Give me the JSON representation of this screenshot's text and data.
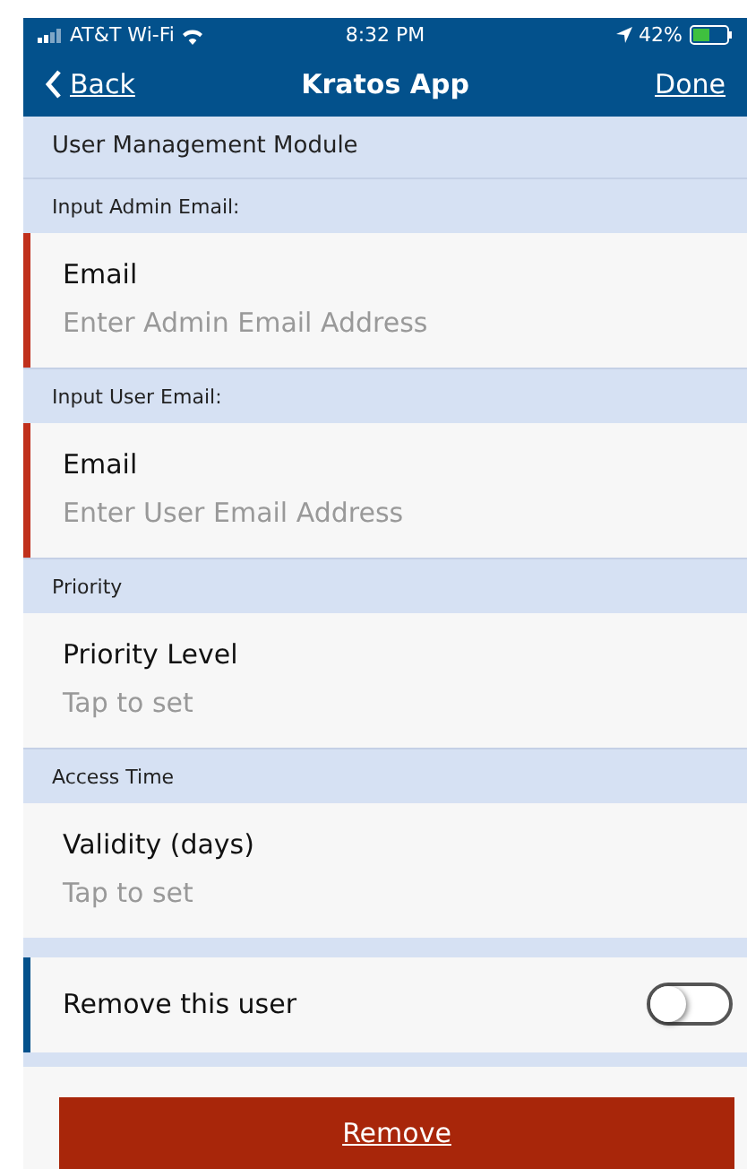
{
  "status_bar": {
    "carrier": "AT&T Wi-Fi",
    "time": "8:32 PM",
    "battery": "42%"
  },
  "nav": {
    "back": "Back",
    "title": "Kratos App",
    "done": "Done"
  },
  "module_title": "User Management Module",
  "sections": [
    {
      "header": "Input Admin Email:",
      "label": "Email",
      "placeholder": "Enter Admin Email Address",
      "kind": "input",
      "required": true
    },
    {
      "header": "Input User Email:",
      "label": "Email",
      "placeholder": "Enter User Email Address",
      "kind": "input",
      "required": true
    },
    {
      "header": "Priority",
      "label": "Priority Level",
      "value": "Tap to set",
      "kind": "picker",
      "required": false
    },
    {
      "header": "Access Time",
      "label": "Validity (days)",
      "value": "Tap to set",
      "kind": "picker",
      "required": false
    }
  ],
  "toggle": {
    "label": "Remove this user",
    "on": false
  },
  "button": "Remove"
}
